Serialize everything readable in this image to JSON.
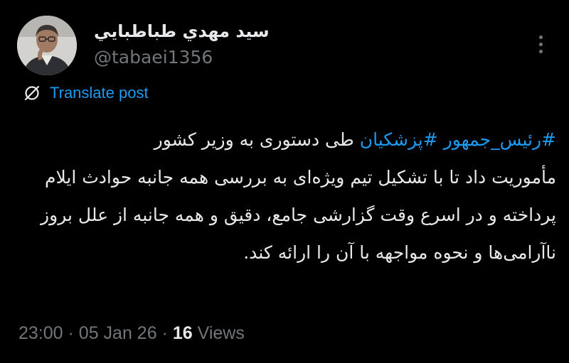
{
  "author": {
    "display_name": "سید مهدي طباطبايي",
    "handle": "@tabaei1356"
  },
  "translate": {
    "icon": "globe-off-icon",
    "label": "Translate post"
  },
  "tweet": {
    "hashtags": [
      "#رئیس_جمهور",
      "#پزشکیان"
    ],
    "text_line1": " طی دستوری به وزیر کشور",
    "text_rest": "مأموریت داد تا با تشکیل تیم ویژه‌ای به بررسی همه جانبه حوادث ایلام پرداخته و در اسرع وقت گزارشی جامع، دقیق و همه جانبه از علل بروز ناآرامی‌ها و نحوه مواجهه با آن را ارائه کند."
  },
  "meta": {
    "time": "23:00",
    "separator": "·",
    "date": "05 Jan 26",
    "views_count": "16",
    "views_label": "Views"
  },
  "colors": {
    "background": "#000000",
    "text": "#e7e9ea",
    "secondary": "#71767b",
    "accent": "#1d9bf0"
  }
}
